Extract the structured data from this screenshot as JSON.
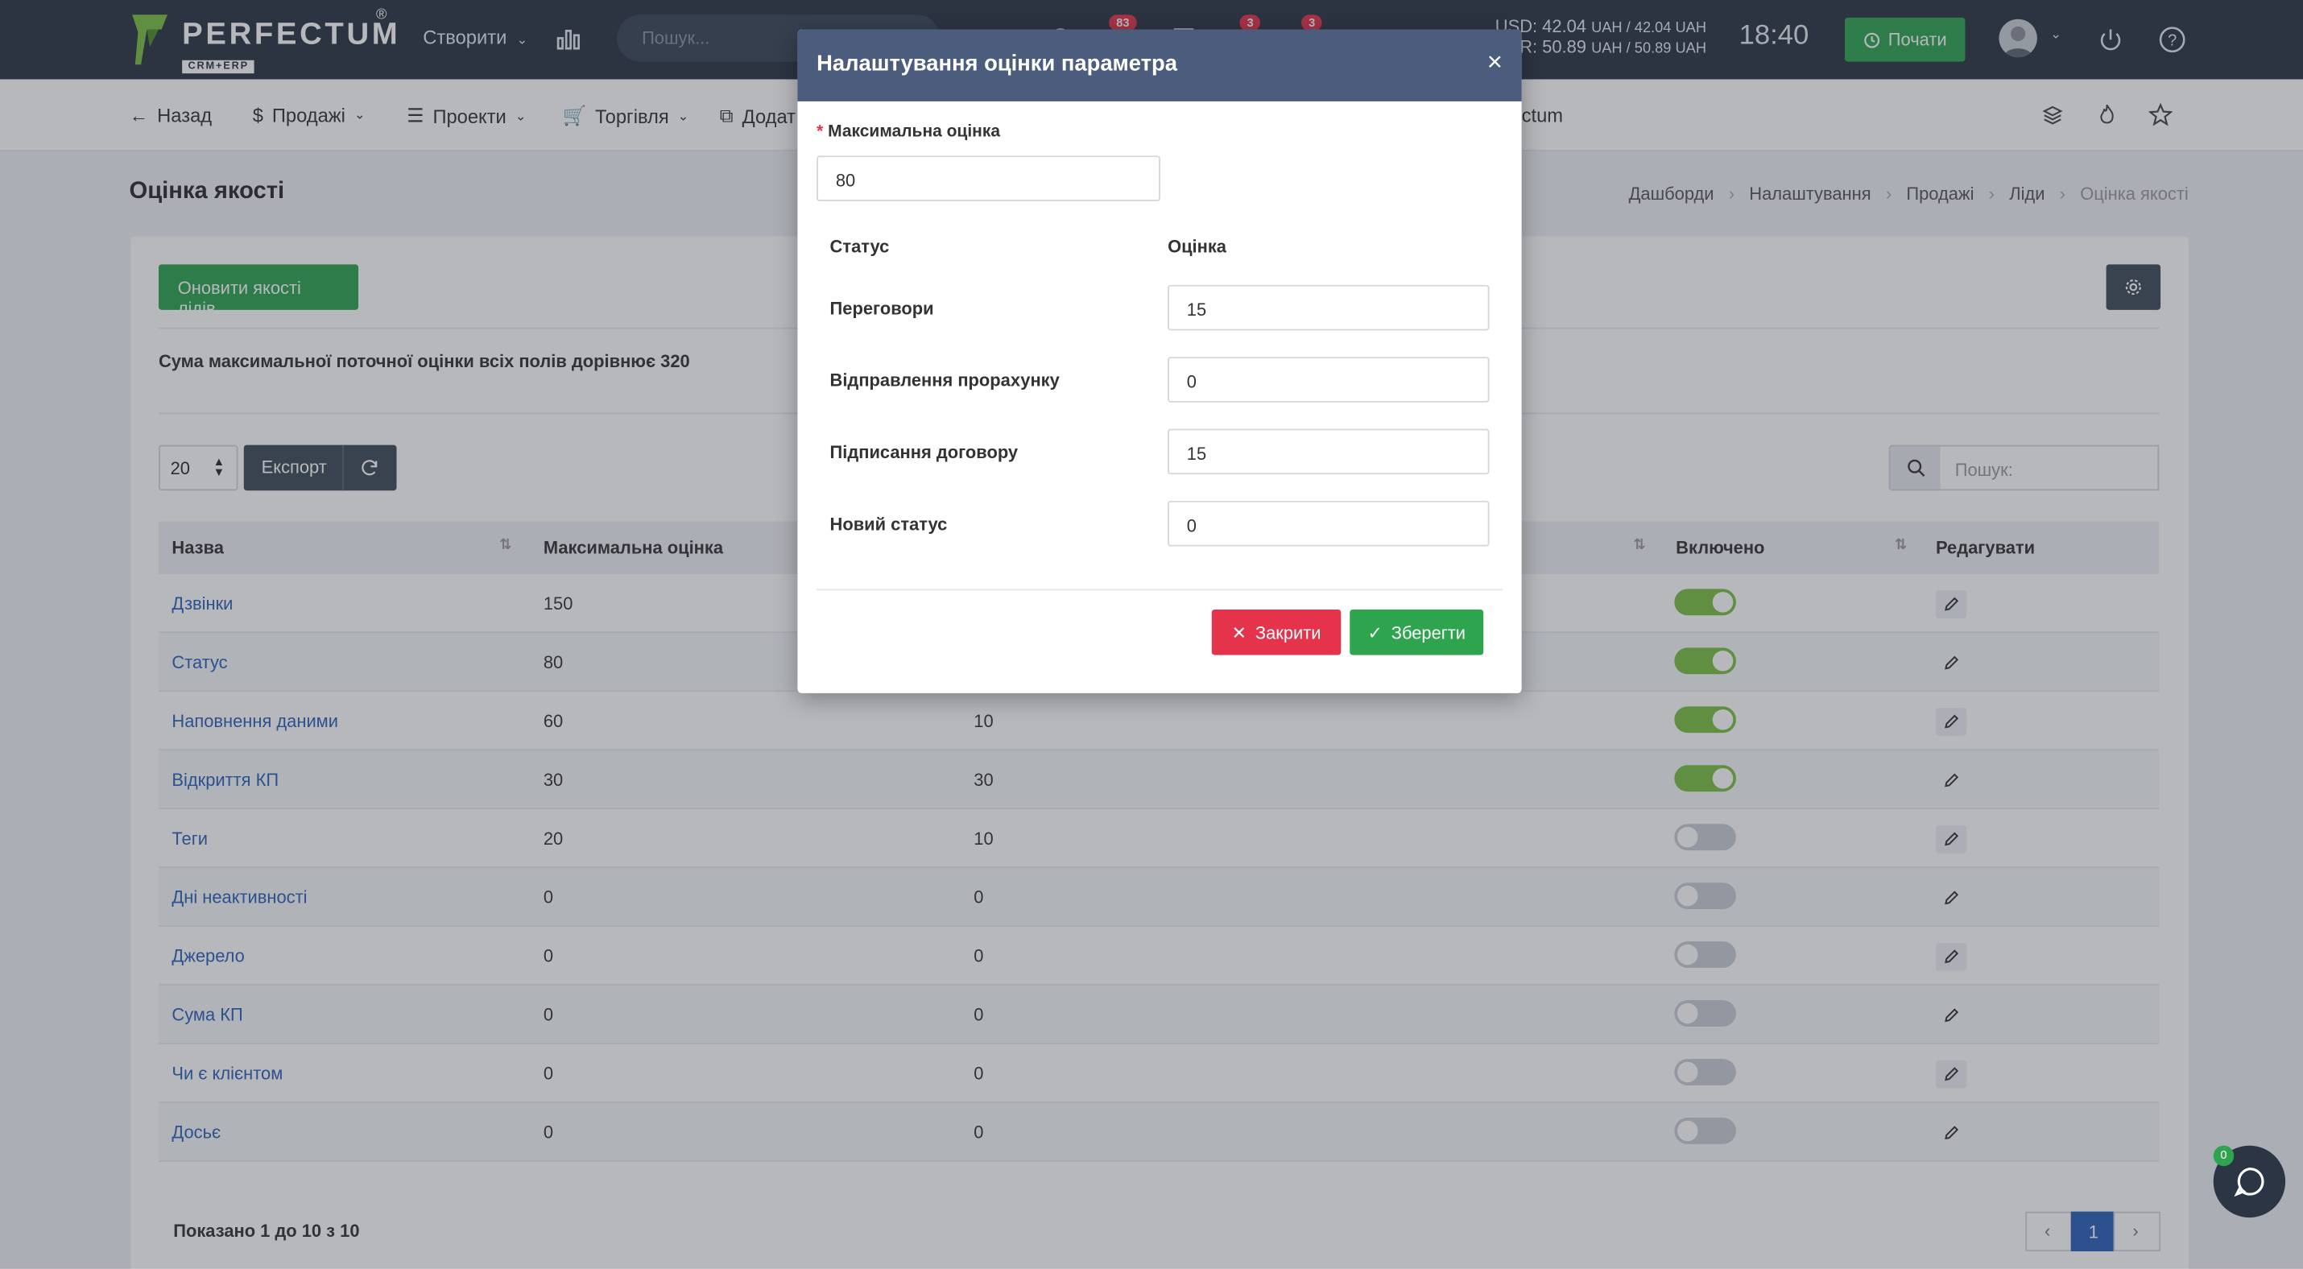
{
  "topbar": {
    "logo_text": "PERFECTUM",
    "logo_sub": "CRM+ERP",
    "logo_reg": "®",
    "create_label": "Створити",
    "search_placeholder": "Пошук...",
    "badges": [
      "83",
      "3",
      "3"
    ],
    "currency_line1": "USD: 42.04",
    "currency_line1_unit": "UAH / 42.04 UAH",
    "currency_line2": "EUR: 50.89",
    "currency_line2_unit": "UAH / 50.89 UAH",
    "clock": "18:40",
    "start_label": "Почати"
  },
  "subnav": {
    "back": "Назад",
    "sales": "Продажі",
    "projects": "Проекти",
    "trade": "Торгівля",
    "extra": "Додат",
    "right_text": "ctum"
  },
  "page": {
    "title": "Оцінка якості",
    "breadcrumbs": [
      "Дашборди",
      "Налаштування",
      "Продажі",
      "Ліди",
      "Оцінка якості"
    ],
    "update_button": "Оновити якості лідів",
    "sum_text": "Сума максимальної поточної оцінки всіх полів дорівнює 320",
    "page_size": "20",
    "export_label": "Експорт",
    "search_placeholder": "Пошук:",
    "footer_text": "Показано 1 до 10 з 10",
    "current_page": "1"
  },
  "table": {
    "headers": [
      "Назва",
      "Максимальна оцінка",
      "Включено",
      "Редагувати"
    ],
    "rows": [
      {
        "name": "Дзвінки",
        "max": "150",
        "cur": "",
        "on": true,
        "boxed": true
      },
      {
        "name": "Статус",
        "max": "80",
        "cur": "",
        "on": true,
        "boxed": false
      },
      {
        "name": "Наповнення даними",
        "max": "60",
        "cur": "10",
        "on": true,
        "boxed": true
      },
      {
        "name": "Відкриття КП",
        "max": "30",
        "cur": "30",
        "on": true,
        "boxed": false
      },
      {
        "name": "Теги",
        "max": "20",
        "cur": "10",
        "on": false,
        "boxed": true
      },
      {
        "name": "Дні неактивності",
        "max": "0",
        "cur": "0",
        "on": false,
        "boxed": false
      },
      {
        "name": "Джерело",
        "max": "0",
        "cur": "0",
        "on": false,
        "boxed": true
      },
      {
        "name": "Сума КП",
        "max": "0",
        "cur": "0",
        "on": false,
        "boxed": false
      },
      {
        "name": "Чи є клієнтом",
        "max": "0",
        "cur": "0",
        "on": false,
        "boxed": true
      },
      {
        "name": "Досьє",
        "max": "0",
        "cur": "0",
        "on": false,
        "boxed": false
      }
    ]
  },
  "modal": {
    "title": "Налаштування оцінки параметра",
    "close_symbol": "×",
    "max_label": "Максимальна оцінка",
    "required_mark": "*",
    "max_value": "80",
    "col_status": "Статус",
    "col_score": "Оцінка",
    "rows": [
      {
        "label": "Переговори",
        "value": "15"
      },
      {
        "label": "Відправлення прорахунку",
        "value": "0"
      },
      {
        "label": "Підписання договору",
        "value": "15"
      },
      {
        "label": "Новий статус",
        "value": "0"
      }
    ],
    "cancel_label": "Закрити",
    "save_label": "Зберегти"
  },
  "chat": {
    "badge": "0"
  },
  "colors": {
    "topbar": "#2b3544",
    "green": "#2fa44f",
    "red": "#e5334b",
    "modal_header": "#4b5c7d",
    "link": "#2c62b8"
  }
}
